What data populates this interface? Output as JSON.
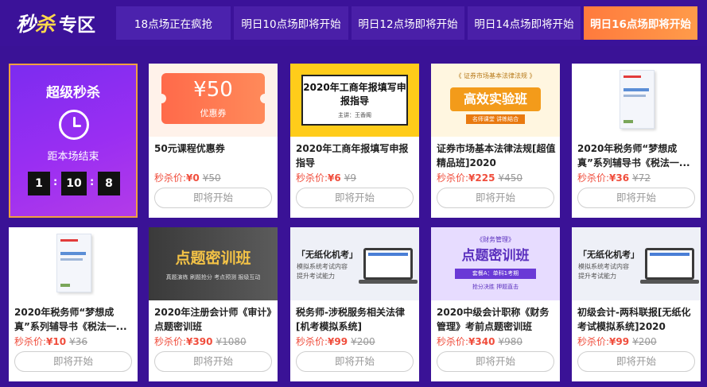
{
  "header": {
    "logo_main": "秒",
    "logo_accent": "杀",
    "logo_section": "专区",
    "tabs": [
      {
        "label": "18点场正在疯抢"
      },
      {
        "label": "明日10点场即将开始"
      },
      {
        "label": "明日12点场即将开始"
      },
      {
        "label": "明日14点场即将开始"
      },
      {
        "label": "明日16点场即将开始"
      }
    ]
  },
  "countdown": {
    "title": "超级秒杀",
    "subtitle": "距本场结束",
    "hours": "1",
    "minutes": "10",
    "seconds": "8",
    "separator": ":"
  },
  "products": [
    {
      "name": "50元课程优惠券",
      "price_label": "秒杀价:",
      "price": "¥0",
      "original": "¥50",
      "button": "即将开始",
      "thumb": {
        "amount": "¥50",
        "label": "优惠券"
      }
    },
    {
      "name": "2020年工商年报填写申报指导",
      "price_label": "秒杀价:",
      "price": "¥6",
      "original": "¥9",
      "button": "即将开始",
      "thumb": {
        "title": "2020年工商年报填写申报指导",
        "sub": "主讲：王香阁"
      }
    },
    {
      "name": "证券市场基本法律法规[超值精品班]2020",
      "price_label": "秒杀价:",
      "price": "¥225",
      "original": "¥450",
      "button": "即将开始",
      "thumb": {
        "top": "《 证券市场基本法律法规 》",
        "main": "高效实验班",
        "sub": "名师课堂 讲练结合"
      }
    },
    {
      "name": "2020年税务师“梦想成真”系列辅导书《税法一...",
      "price_label": "秒杀价:",
      "price": "¥36",
      "original": "¥72",
      "button": "即将开始"
    },
    {
      "name": "2020年税务师“梦想成真”系列辅导书《税法一...",
      "price_label": "秒杀价:",
      "price": "¥10",
      "original": "¥36",
      "button": "即将开始"
    },
    {
      "name": "2020年注册会计师《审计》点题密训班",
      "price_label": "秒杀价:",
      "price": "¥390",
      "original": "¥1080",
      "button": "即将开始",
      "thumb": {
        "main": "点题密训班",
        "sub": "真题演练  刷题抢分  考点预测  报级互动"
      }
    },
    {
      "name": "税务师-涉税服务相关法律[机考模拟系统]",
      "price_label": "秒杀价:",
      "price": "¥99",
      "original": "¥200",
      "button": "即将开始",
      "thumb": {
        "title": "「无纸化机考」",
        "sub": "模拟系统考试内容 提升考试能力"
      }
    },
    {
      "name": "2020中级会计职称《财务管理》考前点题密训班",
      "price_label": "秒杀价:",
      "price": "¥340",
      "original": "¥980",
      "button": "即将开始",
      "thumb": {
        "top": "《财务管理》",
        "main": "点题密训班",
        "badge": "套餐A：单科1考期",
        "sub": "抢分决胜  押题直击"
      }
    },
    {
      "name": "初级会计-两科联报[无纸化考试模拟系统]2020",
      "price_label": "秒杀价:",
      "price": "¥99",
      "original": "¥200",
      "button": "即将开始",
      "thumb": {
        "title": "「无纸化机考」",
        "sub": "模拟系统考试内容 提升考试能力"
      }
    }
  ]
}
